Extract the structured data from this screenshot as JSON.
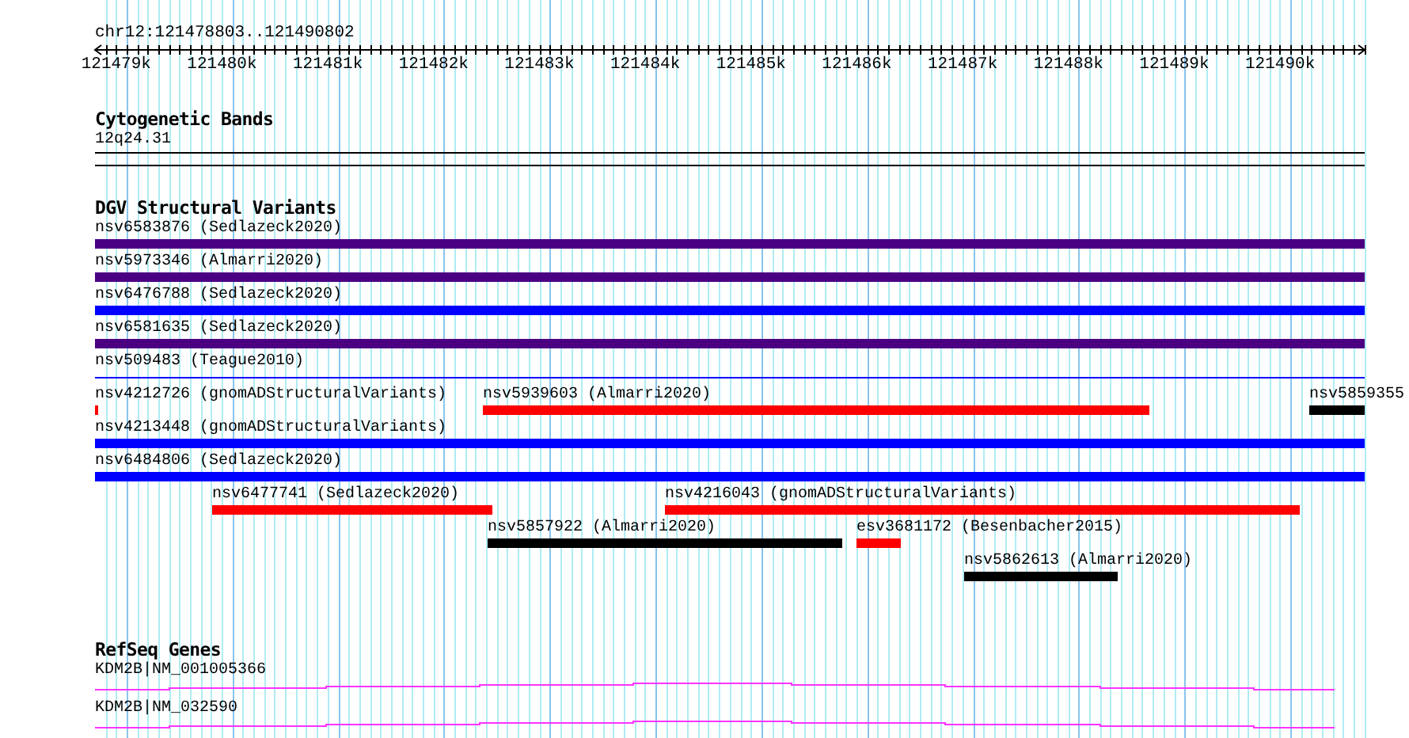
{
  "ruler": {
    "location": "chr12:121478803..121490802",
    "ticks": [
      "121479k",
      "121480k",
      "121481k",
      "121482k",
      "121483k",
      "121484k",
      "121485k",
      "121486k",
      "121487k",
      "121488k",
      "121489k",
      "121490k"
    ]
  },
  "tracks": [
    {
      "kind": "bands",
      "title": "Cytogenetic Bands",
      "items": [
        {
          "label": "12q24.31"
        }
      ]
    },
    {
      "kind": "features",
      "title": "DGV Structural Variants",
      "rows": [
        [
          {
            "kind": "bar",
            "label": "nsv6583876 (Sedlazeck2020)",
            "color": "#4b0082"
          }
        ],
        [
          {
            "kind": "bar",
            "label": "nsv5973346 (Almarri2020)",
            "color": "#4b0082"
          }
        ],
        [
          {
            "kind": "bar",
            "label": "nsv6476788 (Sedlazeck2020)",
            "color": "#0000ff"
          }
        ],
        [
          {
            "kind": "bar",
            "label": "nsv6581635 (Sedlazeck2020)",
            "color": "#4b0082"
          }
        ],
        [
          {
            "kind": "line",
            "label": "nsv509483 (Teague2010)",
            "color": "#0000ff"
          }
        ],
        [
          {
            "kind": "bar",
            "label": "nsv4212726 (gnomADStructuralVariants)",
            "color": "#ff0000"
          },
          {
            "kind": "bar",
            "label": "nsv5939603 (Almarri2020)",
            "color": "#ff0000"
          },
          {
            "kind": "bar",
            "label": "nsv5859355",
            "color": "#000000"
          }
        ],
        [
          {
            "kind": "bar",
            "label": "nsv4213448 (gnomADStructuralVariants)",
            "color": "#0000ff"
          }
        ],
        [
          {
            "kind": "bar",
            "label": "nsv6484806 (Sedlazeck2020)",
            "color": "#0000ff"
          }
        ],
        [
          {
            "kind": "bar",
            "label": "nsv6477741 (Sedlazeck2020)",
            "color": "#ff0000"
          },
          {
            "kind": "bar",
            "label": "nsv4216043 (gnomADStructuralVariants)",
            "color": "#ff0000"
          }
        ],
        [
          {
            "kind": "bar",
            "label": "nsv5857922 (Almarri2020)",
            "color": "#000000"
          },
          {
            "kind": "bar",
            "label": "esv3681172 (Besenbacher2015)",
            "color": "#ff0000"
          }
        ],
        [
          {
            "kind": "bar",
            "label": "nsv5862613 (Almarri2020)",
            "color": "#000000"
          }
        ]
      ]
    },
    {
      "kind": "genes",
      "title": "RefSeq Genes",
      "items": [
        {
          "label": "KDM2B|NM_001005366"
        },
        {
          "label": "KDM2B|NM_032590"
        }
      ]
    }
  ]
}
